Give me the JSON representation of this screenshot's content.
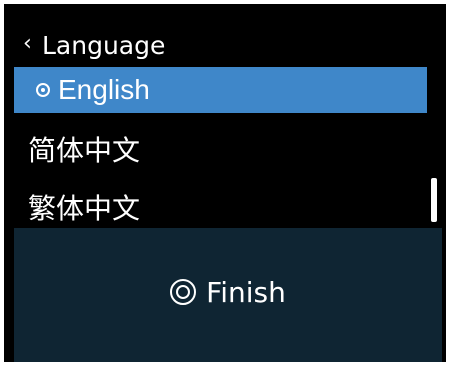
{
  "header": {
    "back_icon": "chevron-left-icon",
    "title": "Language"
  },
  "languages": [
    {
      "label": "English",
      "selected": true
    },
    {
      "label": "简体中文",
      "selected": false
    },
    {
      "label": "繁体中文",
      "selected": false
    }
  ],
  "footer": {
    "finish_icon": "double-circle-icon",
    "finish_label": "Finish"
  },
  "colors": {
    "screen_background": "#000000",
    "selected_background": "#3f87c9",
    "footer_background": "#0f2533",
    "text": "#ffffff"
  }
}
